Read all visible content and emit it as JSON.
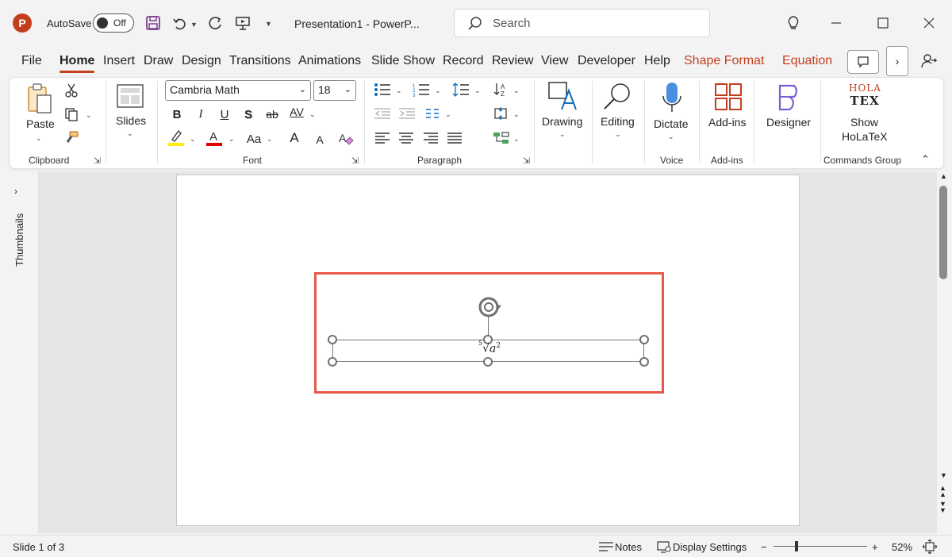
{
  "titlebar": {
    "app_badge": "P",
    "autosave_label": "AutoSave",
    "autosave_state": "Off",
    "doc_title": "Presentation1  -  PowerP...",
    "search_placeholder": "Search"
  },
  "tabs": [
    {
      "label": "File"
    },
    {
      "label": "Home"
    },
    {
      "label": "Insert"
    },
    {
      "label": "Draw"
    },
    {
      "label": "Design"
    },
    {
      "label": "Transitions"
    },
    {
      "label": "Animations"
    },
    {
      "label": "Slide Show"
    },
    {
      "label": "Record"
    },
    {
      "label": "Review"
    },
    {
      "label": "View"
    },
    {
      "label": "Developer"
    },
    {
      "label": "Help"
    },
    {
      "label": "Shape Format"
    },
    {
      "label": "Equation"
    }
  ],
  "ribbon": {
    "clipboard": {
      "paste": "Paste",
      "group": "Clipboard"
    },
    "slides": {
      "label": "Slides"
    },
    "font": {
      "family": "Cambria Math",
      "size": "18",
      "group": "Font",
      "bold": "B",
      "italic": "I",
      "underline": "U",
      "shadow": "S",
      "strike": "ab",
      "spacing": "AV",
      "case": "Aa",
      "grow": "A",
      "shrink": "A"
    },
    "paragraph": {
      "group": "Paragraph"
    },
    "drawing": {
      "label": "Drawing"
    },
    "editing": {
      "label": "Editing"
    },
    "voice": {
      "dictate": "Dictate",
      "group": "Voice"
    },
    "addins": {
      "label": "Add-ins",
      "group": "Add-ins"
    },
    "designer": {
      "label": "Designer"
    },
    "holatex": {
      "logo_top": "HOLA",
      "logo_bottom": "TEX",
      "label1": "Show",
      "label2": "HoLaTeX",
      "group": "Commands Group"
    }
  },
  "thumbnails": {
    "label": "Thumbnails"
  },
  "equation": {
    "index": "5",
    "radical": "√",
    "base": "a",
    "power": "2"
  },
  "statusbar": {
    "slide_info": "Slide 1 of 3",
    "notes": "Notes",
    "display_settings": "Display Settings",
    "zoom_minus": "−",
    "zoom_plus": "+",
    "zoom_level": "52%"
  },
  "colors": {
    "accent": "#c43e1c",
    "highlight_box": "#e8584a",
    "highlight_yellow": "#ffee00",
    "font_red": "#e00000"
  }
}
